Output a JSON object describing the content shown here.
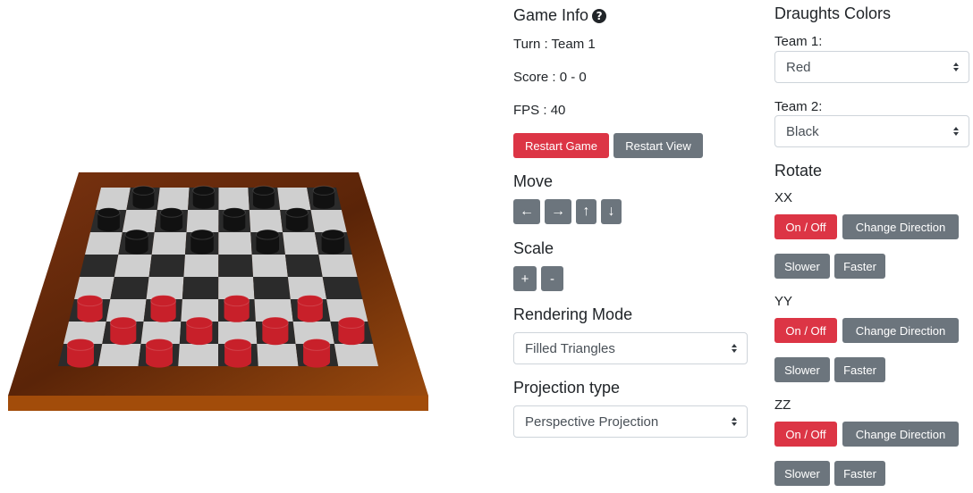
{
  "game_info": {
    "title": "Game Info",
    "turn_label": "Turn :",
    "turn_value": "Team 1",
    "score_label": "Score :",
    "score_value": "0 - 0",
    "fps_label": "FPS :",
    "fps_value": "40",
    "restart_game": "Restart Game",
    "restart_view": "Restart View"
  },
  "move": {
    "title": "Move",
    "left": "←",
    "right": "→",
    "up": "↑",
    "down": "↓"
  },
  "scale": {
    "title": "Scale",
    "plus": "+",
    "minus": "-"
  },
  "rendering": {
    "title": "Rendering Mode",
    "selected": "Filled Triangles"
  },
  "projection": {
    "title": "Projection type",
    "selected": "Perspective Projection"
  },
  "colors": {
    "title": "Draughts Colors",
    "team1_label": "Team 1:",
    "team1_value": "Red",
    "team2_label": "Team 2:",
    "team2_value": "Black"
  },
  "rotate": {
    "title": "Rotate",
    "axes": [
      {
        "name": "XX",
        "toggle": "On / Off",
        "direction": "Change Direction",
        "slower": "Slower",
        "faster": "Faster"
      },
      {
        "name": "YY",
        "toggle": "On / Off",
        "direction": "Change Direction",
        "slower": "Slower",
        "faster": "Faster"
      },
      {
        "name": "ZZ",
        "toggle": "On / Off",
        "direction": "Change Direction",
        "slower": "Slower",
        "faster": "Faster"
      }
    ]
  },
  "theme": {
    "danger": "#dc3545",
    "secondary": "#6c757d",
    "board_wood": "#8a3d0c",
    "square_light": "#cfcfcf",
    "square_dark": "#2b2b2b",
    "piece_red": "#c8202a",
    "piece_black": "#111111"
  }
}
